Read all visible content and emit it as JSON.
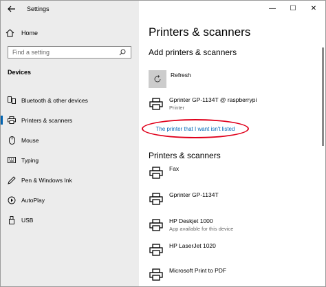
{
  "app": {
    "title": "Settings"
  },
  "window_controls": {
    "minimize": "—",
    "maximize": "☐",
    "close": "✕"
  },
  "sidebar": {
    "home_label": "Home",
    "search_placeholder": "Find a setting",
    "section_header": "Devices",
    "items": [
      {
        "label": "Bluetooth & other devices",
        "icon": "bluetooth-devices-icon"
      },
      {
        "label": "Printers & scanners",
        "icon": "printer-icon",
        "active": true
      },
      {
        "label": "Mouse",
        "icon": "mouse-icon"
      },
      {
        "label": "Typing",
        "icon": "keyboard-icon"
      },
      {
        "label": "Pen & Windows Ink",
        "icon": "pen-icon"
      },
      {
        "label": "AutoPlay",
        "icon": "autoplay-icon"
      },
      {
        "label": "USB",
        "icon": "usb-icon"
      }
    ]
  },
  "main": {
    "page_title": "Printers & scanners",
    "add_section": {
      "heading": "Add printers & scanners",
      "refresh_label": "Refresh",
      "discovered": [
        {
          "name": "Gprinter GP-1134T @ raspberrypi",
          "status": "Printer"
        }
      ],
      "not_listed_link": "The printer that I want isn't listed"
    },
    "installed_section": {
      "heading": "Printers & scanners",
      "devices": [
        {
          "name": "Fax",
          "status": ""
        },
        {
          "name": "Gprinter GP-1134T",
          "status": ""
        },
        {
          "name": "HP Deskjet 1000",
          "status": "App available for this device"
        },
        {
          "name": "HP LaserJet 1020",
          "status": ""
        },
        {
          "name": "Microsoft Print to PDF",
          "status": ""
        }
      ]
    }
  },
  "colors": {
    "accent": "#0063b1",
    "link": "#0067b8",
    "annotation": "#e0001b",
    "sidebar_bg": "#ececec"
  }
}
